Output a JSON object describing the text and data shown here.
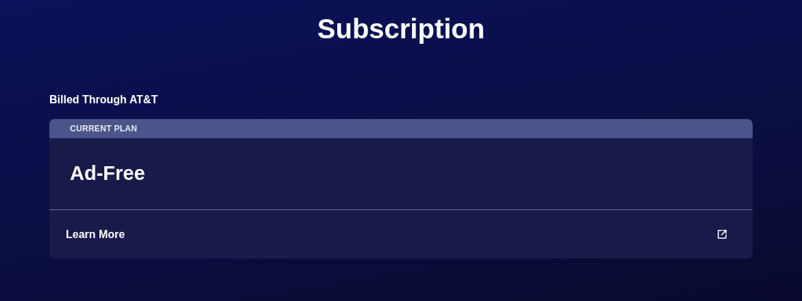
{
  "page": {
    "title": "Subscription"
  },
  "billing": {
    "label": "Billed Through AT&T"
  },
  "plan_card": {
    "header": "CURRENT PLAN",
    "plan_name": "Ad-Free",
    "link": {
      "label": "Learn More"
    }
  }
}
